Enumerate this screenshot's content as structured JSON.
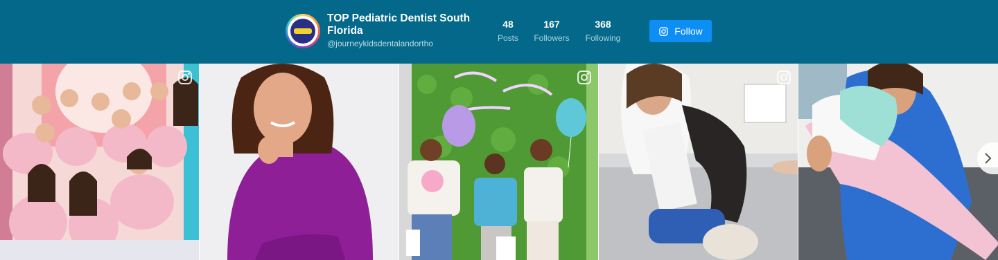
{
  "profile": {
    "name": "TOP Pediatric Dentist South Florida",
    "handle": "@journeykidsdentalandortho"
  },
  "stats": [
    {
      "value": "48",
      "label": "Posts"
    },
    {
      "value": "167",
      "label": "Followers"
    },
    {
      "value": "368",
      "label": "Following"
    }
  ],
  "follow_button": {
    "label": "Follow"
  },
  "colors": {
    "header_bg": "#04688a",
    "follow_bg": "#0d8ef5",
    "text_light": "#ffffff"
  },
  "icons": {
    "follow": "instagram-icon",
    "post_type": "instagram-icon",
    "next": "chevron-right-icon"
  },
  "posts": [
    {
      "kind": "photo",
      "ig_badge": true
    },
    {
      "kind": "photo",
      "ig_badge": false
    },
    {
      "kind": "photo",
      "ig_badge": true
    },
    {
      "kind": "photo",
      "ig_badge": true
    },
    {
      "kind": "photo",
      "ig_badge": false
    }
  ]
}
